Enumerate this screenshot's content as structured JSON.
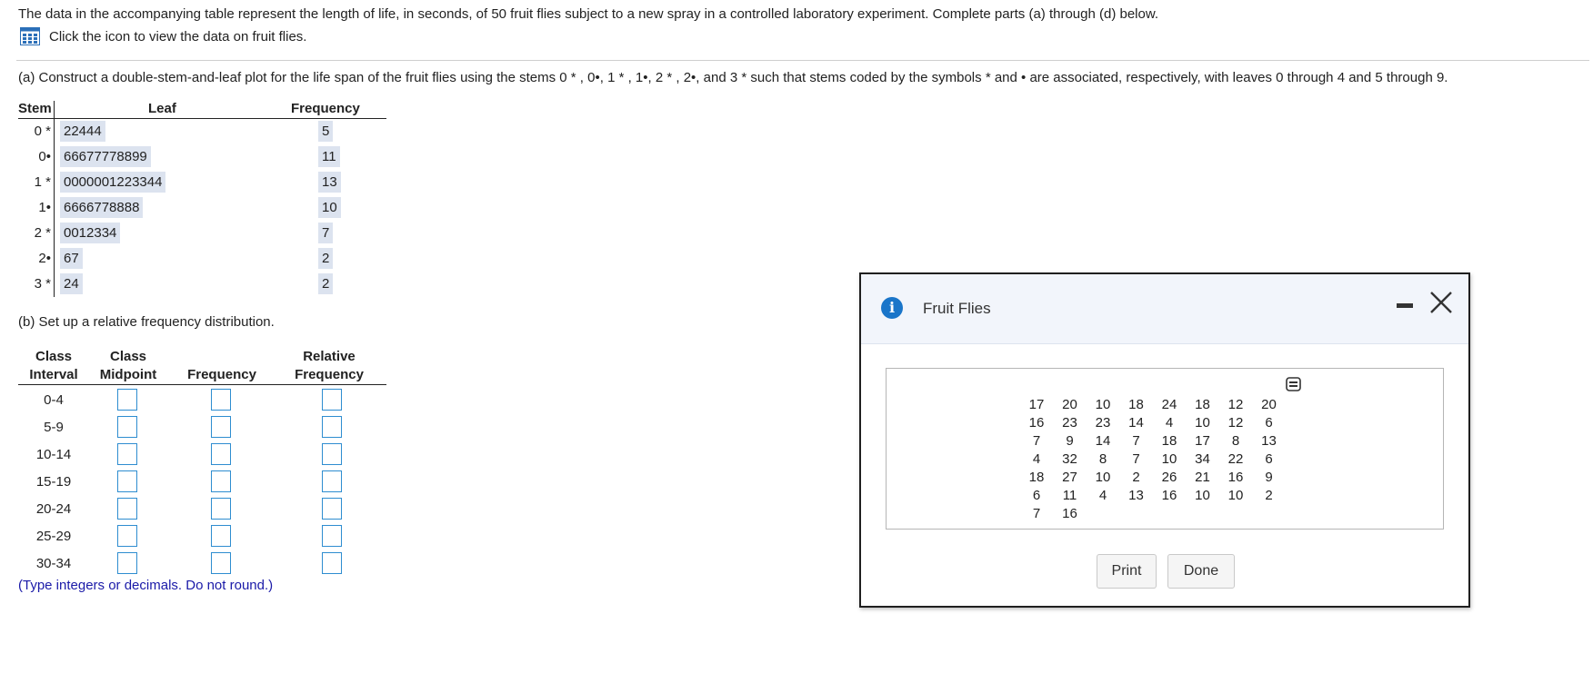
{
  "intro_text": "The data in the accompanying table represent the length of life, in seconds, of 50 fruit flies subject to a new spray in a controlled laboratory experiment. Complete parts (a) through (d) below.",
  "data_link_text": "Click the icon to view the data on fruit flies.",
  "part_a": {
    "prefix": "(a) Construct a double-stem-and-leaf plot for the life span of the fruit flies using the stems ",
    "stems_inline": "0 * , 0•, 1 * , 1•, 2 * , 2•, and 3 *",
    "middle": " such that stems coded by the symbols ",
    "star": "*",
    "and": " and ",
    "bullet": "•",
    "suffix": " are associated, respectively, with leaves 0 through 4 and 5 through 9."
  },
  "stem_leaf": {
    "headers": {
      "stem": "Stem",
      "leaf": "Leaf",
      "frequency": "Frequency"
    },
    "rows": [
      {
        "stem": "0 *",
        "leaf": "22444",
        "freq": "5"
      },
      {
        "stem": "0•",
        "leaf": "66677778899",
        "freq": "11"
      },
      {
        "stem": "1 *",
        "leaf": "0000001223344",
        "freq": "13"
      },
      {
        "stem": "1•",
        "leaf": "6666778888",
        "freq": "10"
      },
      {
        "stem": "2 *",
        "leaf": "0012334",
        "freq": "7"
      },
      {
        "stem": "2•",
        "leaf": "67",
        "freq": "2"
      },
      {
        "stem": "3 *",
        "leaf": "24",
        "freq": "2"
      }
    ]
  },
  "part_b": "(b) Set up a relative frequency distribution.",
  "rel_freq": {
    "headers": {
      "class_interval_1": "Class",
      "class_interval_2": "Interval",
      "midpoint_1": "Class",
      "midpoint_2": "Midpoint",
      "frequency": "Frequency",
      "relative_1": "Relative",
      "relative_2": "Frequency"
    },
    "intervals": [
      "0-4",
      "5-9",
      "10-14",
      "15-19",
      "20-24",
      "25-29",
      "30-34"
    ]
  },
  "note": "(Type integers or decimals. Do not round.)",
  "dialog": {
    "title": "Fruit Flies",
    "columns": [
      [
        "17",
        "16",
        "7",
        "4",
        "18",
        "6",
        "7"
      ],
      [
        "20",
        "23",
        "9",
        "32",
        "27",
        "11",
        "16"
      ],
      [
        "10",
        "23",
        "14",
        "8",
        "10",
        "4"
      ],
      [
        "18",
        "14",
        "7",
        "7",
        "2",
        "13"
      ],
      [
        "24",
        "4",
        "18",
        "10",
        "26",
        "16"
      ],
      [
        "18",
        "10",
        "17",
        "34",
        "21",
        "10"
      ],
      [
        "12",
        "12",
        "8",
        "22",
        "16",
        "10"
      ],
      [
        "20",
        "6",
        "13",
        "6",
        "9",
        "2"
      ]
    ],
    "print_label": "Print",
    "done_label": "Done"
  },
  "colors": {
    "highlight": "#dce3ef",
    "input_border": "#2e8dd0",
    "info": "#1a75c9",
    "note": "#1a1aa8"
  }
}
